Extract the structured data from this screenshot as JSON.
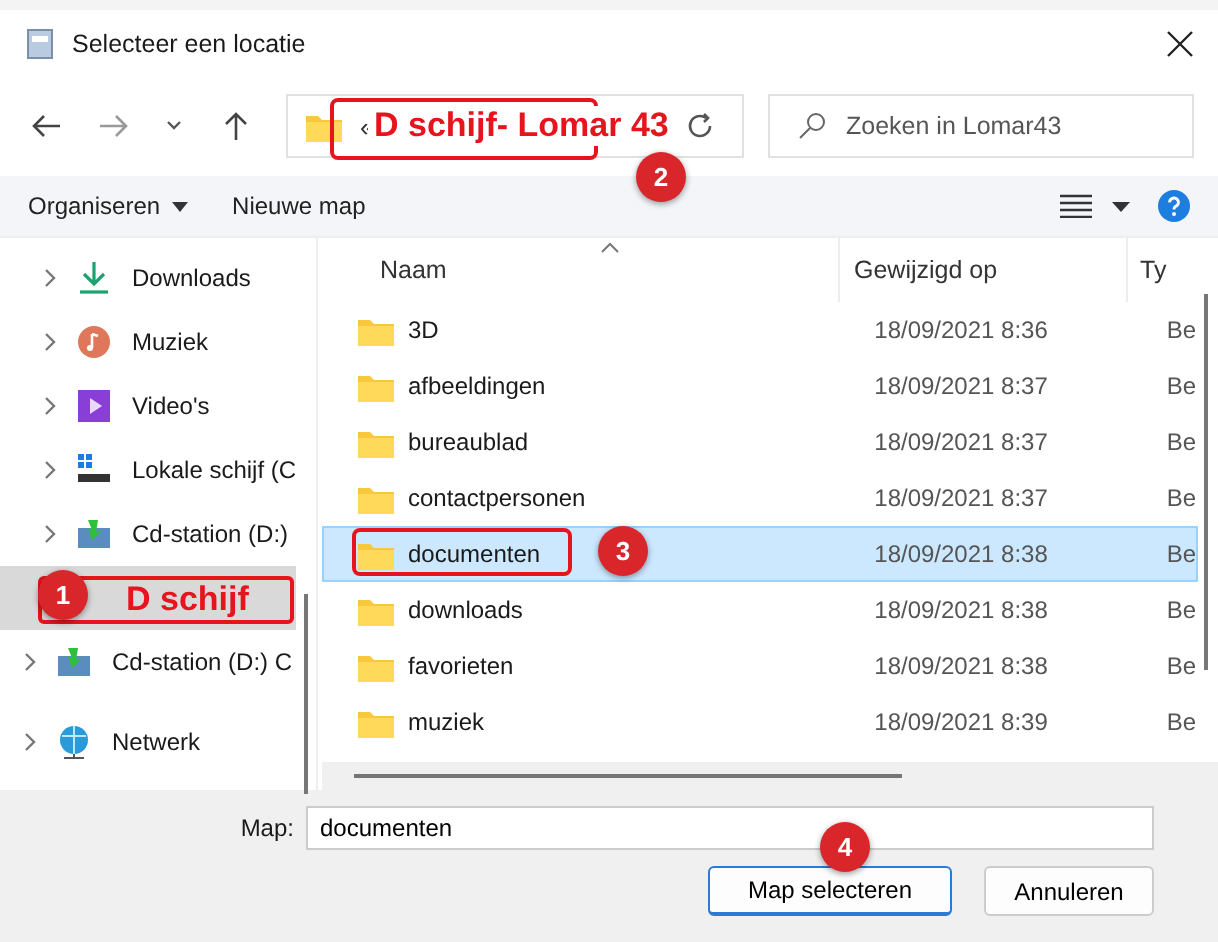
{
  "window": {
    "title": "Selecteer een locatie"
  },
  "address": {
    "overflow": "«"
  },
  "search": {
    "placeholder": "Zoeken in Lomar43"
  },
  "toolbar": {
    "organize": "Organiseren",
    "new_folder": "Nieuwe map"
  },
  "sidebar": {
    "items": [
      {
        "kind": "download",
        "label": "Downloads",
        "selected": false
      },
      {
        "kind": "music",
        "label": "Muziek",
        "selected": false
      },
      {
        "kind": "video",
        "label": "Video's",
        "selected": false
      },
      {
        "kind": "disk",
        "label": "Lokale schijf (C",
        "selected": false
      },
      {
        "kind": "cd",
        "label": "Cd-station (D:)",
        "selected": false
      },
      {
        "kind": "drive",
        "selected": true
      },
      {
        "kind": "cd",
        "label": "Cd-station (D:) C",
        "selected": false
      },
      {
        "kind": "network",
        "label": "Netwerk",
        "selected": false
      }
    ]
  },
  "table": {
    "columns": [
      "Naam",
      "Gewijzigd op",
      "Ty"
    ],
    "rows": [
      {
        "name": "3D",
        "modified": "18/09/2021 8:36",
        "type": "Be",
        "selected": false
      },
      {
        "name": "afbeeldingen",
        "modified": "18/09/2021 8:37",
        "type": "Be",
        "selected": false
      },
      {
        "name": "bureaublad",
        "modified": "18/09/2021 8:37",
        "type": "Be",
        "selected": false
      },
      {
        "name": "contactpersonen",
        "modified": "18/09/2021 8:37",
        "type": "Be",
        "selected": false
      },
      {
        "name": "documenten",
        "modified": "18/09/2021 8:38",
        "type": "Be",
        "selected": true
      },
      {
        "name": "downloads",
        "modified": "18/09/2021 8:38",
        "type": "Be",
        "selected": false
      },
      {
        "name": "favorieten",
        "modified": "18/09/2021 8:38",
        "type": "Be",
        "selected": false
      },
      {
        "name": "muziek",
        "modified": "18/09/2021 8:39",
        "type": "Be",
        "selected": false
      }
    ]
  },
  "footer": {
    "folder_label": "Map:",
    "folder_value": "documenten",
    "buttons": [
      "Map selecteren",
      "Annuleren"
    ]
  },
  "annotations": [
    {
      "number": "1",
      "text": "D schijf"
    },
    {
      "number": "2",
      "text": "D schijf- Lomar 43"
    },
    {
      "number": "3"
    },
    {
      "number": "4"
    }
  ]
}
